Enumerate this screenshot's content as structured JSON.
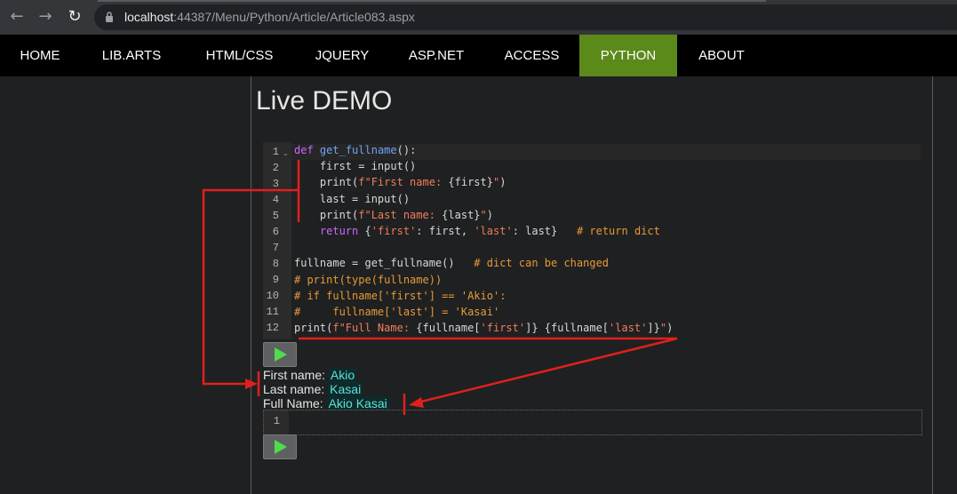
{
  "browser": {
    "url_host": "localhost",
    "url_rest": ":44387/Menu/Python/Article/Article083.aspx",
    "back_icon": "←",
    "forward_icon": "→",
    "reload_icon": "↻"
  },
  "nav": {
    "items": [
      "HOME",
      "LIB.ARTS",
      "HTML/CSS",
      "JQUERY",
      "ASP.NET",
      "ACCESS",
      "PYTHON",
      "ABOUT"
    ],
    "active": "PYTHON",
    "active_color": "#5b8a1b"
  },
  "page": {
    "title": "Live DEMO"
  },
  "editor": {
    "line_numbers": [
      "1",
      "2",
      "3",
      "4",
      "5",
      "6",
      "7",
      "8",
      "9",
      "10",
      "11",
      "12"
    ]
  },
  "output": {
    "first_label": "First name:",
    "first_value": "Akio",
    "last_label": "Last name:",
    "last_value": "Kasai",
    "full_label": "Full Name:",
    "full_value": "Akio Kasai"
  },
  "input_editor": {
    "line_numbers": [
      "1"
    ]
  },
  "colors": {
    "annotation": "#e0201c",
    "keyword": "#cc66ff",
    "function": "#6fa3f2",
    "string": "#ef7d5c",
    "comment": "#e79a36",
    "output_value": "#5fe0d8",
    "run_icon": "#4fdc4f"
  }
}
